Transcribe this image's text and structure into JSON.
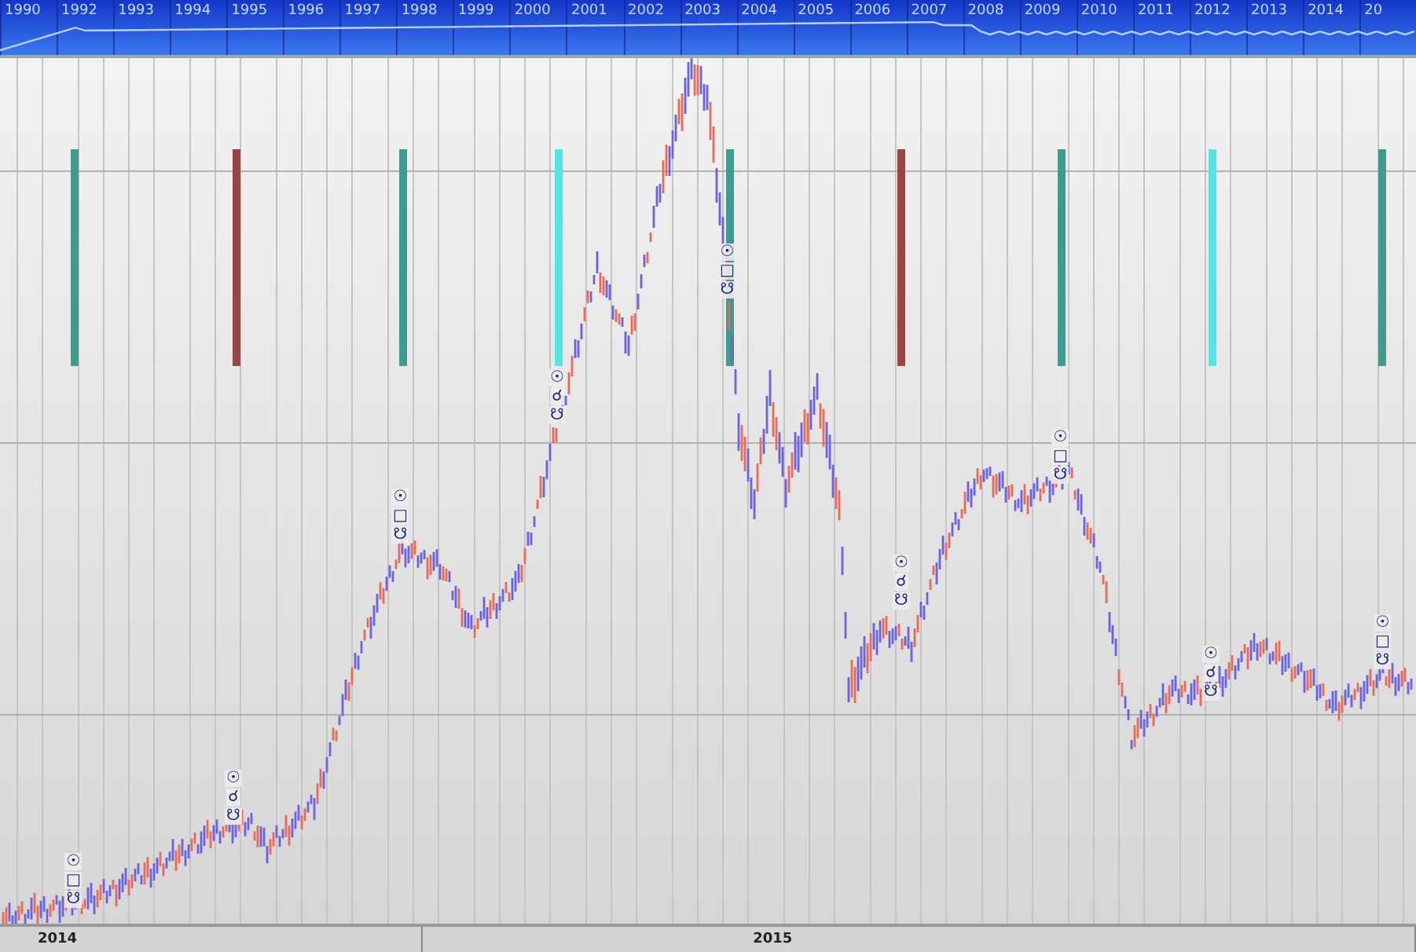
{
  "overview": {
    "years": [
      "1990",
      "1992",
      "1993",
      "1994",
      "1995",
      "1996",
      "1997",
      "1998",
      "1999",
      "2000",
      "2001",
      "2002",
      "2003",
      "2004",
      "2005",
      "2006",
      "2007",
      "2008",
      "2009",
      "2010",
      "2011",
      "2012",
      "2013",
      "2014",
      "20"
    ]
  },
  "chart": {
    "cycle_bars": [
      {
        "color": "#3f9a90"
      },
      {
        "color": "#9a463e"
      },
      {
        "color": "#3f9a90"
      },
      {
        "color": "#55e3e3"
      },
      {
        "color": "#3f9a90"
      },
      {
        "color": "#9a463e"
      },
      {
        "color": "#3f9a90"
      },
      {
        "color": "#55e3e3"
      },
      {
        "color": "#3f9a90"
      }
    ],
    "markers": [
      {
        "glyphs": [
          "☉",
          "□",
          "☋"
        ]
      },
      {
        "glyphs": [
          "☉",
          "☌",
          "☋"
        ]
      },
      {
        "glyphs": [
          "☉",
          "□",
          "☋"
        ]
      },
      {
        "glyphs": [
          "☉",
          "☌",
          "☋"
        ]
      },
      {
        "glyphs": [
          "☉",
          "□",
          "☋"
        ]
      },
      {
        "glyphs": [
          "☉",
          "☌",
          "☋"
        ]
      },
      {
        "glyphs": [
          "☉",
          "□",
          "☋"
        ]
      },
      {
        "glyphs": [
          "☉",
          "☌",
          "☋"
        ]
      },
      {
        "glyphs": [
          "☉",
          "□",
          "☋"
        ]
      }
    ]
  },
  "time_axis": {
    "labels": [
      "2014",
      "2015"
    ]
  }
}
